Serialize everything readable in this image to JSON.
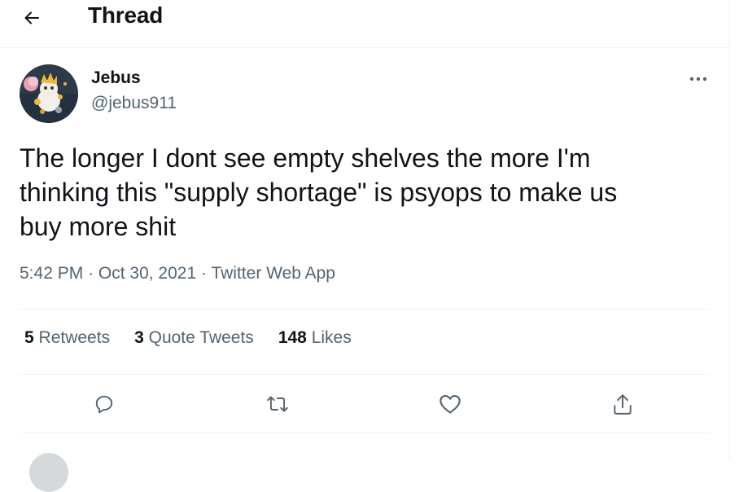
{
  "header": {
    "title": "Thread",
    "back_icon": "arrow-left-icon"
  },
  "tweet": {
    "author": {
      "display_name": "Jebus",
      "handle": "@jebus911"
    },
    "text_lines": [
      "The longer I dont see empty shelves the more I'm",
      "thinking this \"supply shortage\" is psyops to make us",
      "buy more shit"
    ],
    "meta": {
      "time": "5:42 PM",
      "date": "Oct 30, 2021",
      "source": "Twitter Web App",
      "separator": "·"
    },
    "stats": {
      "retweets": {
        "count": "5",
        "label": "Retweets"
      },
      "quote_tweets": {
        "count": "3",
        "label": "Quote Tweets"
      },
      "likes": {
        "count": "148",
        "label": "Likes"
      }
    },
    "actions": [
      "reply-icon",
      "retweet-icon",
      "like-icon",
      "share-icon"
    ]
  },
  "colors": {
    "text": "#0f1419",
    "secondary": "#536471",
    "divider": "#eff3f4",
    "background": "#ffffff"
  }
}
